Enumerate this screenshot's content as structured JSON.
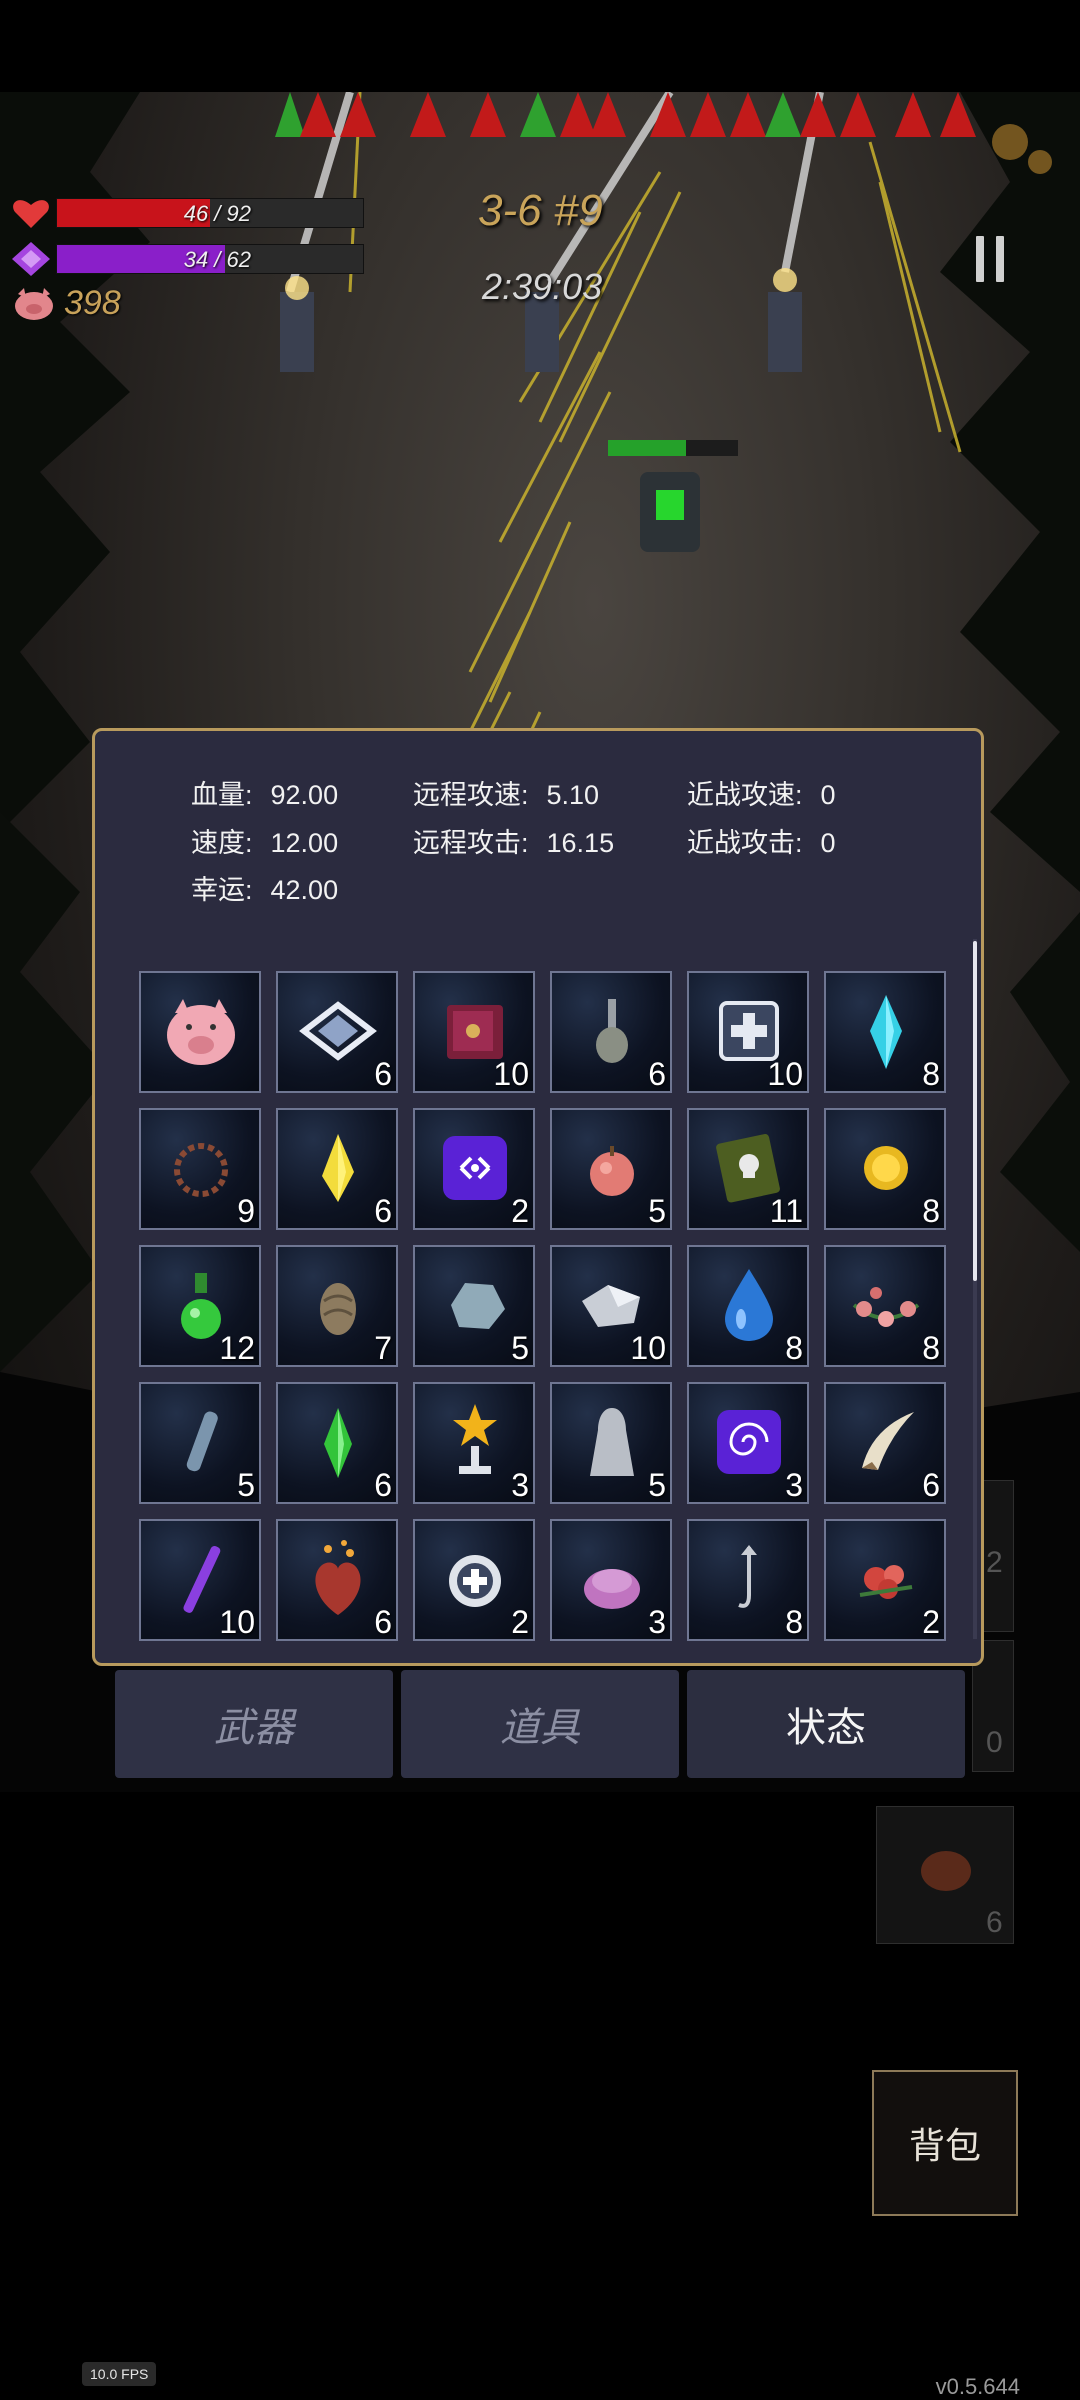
{
  "hud": {
    "hp_text": "46 / 92",
    "hp_fraction": 0.5,
    "hp_color": "#c8131b",
    "mp_text": "34 / 62",
    "mp_fraction": 0.548,
    "mp_color": "#8a1fc9",
    "gold": "398",
    "stage": "3-6 #9",
    "timer": "2:39:03",
    "icons": [
      "heart-icon",
      "mana-gem-icon",
      "piggy-icon",
      "pause-icon"
    ]
  },
  "stats": {
    "hp_label": "血量:",
    "hp_value": "92.00",
    "speed_label": "速度:",
    "speed_value": "12.00",
    "luck_label": "幸运:",
    "luck_value": "42.00",
    "ranged_speed_label": "远程攻速:",
    "ranged_speed_value": "5.10",
    "ranged_attack_label": "远程攻击:",
    "ranged_attack_value": "16.15",
    "melee_speed_label": "近战攻速:",
    "melee_speed_value": "0",
    "melee_attack_label": "近战攻击:",
    "melee_attack_value": "0"
  },
  "items": [
    {
      "icon": "piggy-bank-icon",
      "count": ""
    },
    {
      "icon": "diamond-plate-icon",
      "count": "6"
    },
    {
      "icon": "spellbook-icon",
      "count": "10"
    },
    {
      "icon": "vase-icon",
      "count": "6"
    },
    {
      "icon": "medkit-box-icon",
      "count": "10"
    },
    {
      "icon": "cyan-crystal-icon",
      "count": "8"
    },
    {
      "icon": "thorn-ring-icon",
      "count": "9"
    },
    {
      "icon": "yellow-gem-icon",
      "count": "6"
    },
    {
      "icon": "purple-rune-icon",
      "count": "2"
    },
    {
      "icon": "peach-fruit-icon",
      "count": "5"
    },
    {
      "icon": "skull-book-icon",
      "count": "11"
    },
    {
      "icon": "gold-orb-icon",
      "count": "8"
    },
    {
      "icon": "green-potion-icon",
      "count": "12"
    },
    {
      "icon": "seed-pod-icon",
      "count": "7"
    },
    {
      "icon": "stone-icon",
      "count": "5"
    },
    {
      "icon": "silver-ore-icon",
      "count": "10"
    },
    {
      "icon": "water-drop-icon",
      "count": "8"
    },
    {
      "icon": "flower-garland-icon",
      "count": "8"
    },
    {
      "icon": "vial-icon",
      "count": "5"
    },
    {
      "icon": "green-crystal-icon",
      "count": "6"
    },
    {
      "icon": "star-trophy-icon",
      "count": "3"
    },
    {
      "icon": "cloak-figure-icon",
      "count": "5"
    },
    {
      "icon": "purple-swirl-icon",
      "count": "3"
    },
    {
      "icon": "horn-icon",
      "count": "6"
    },
    {
      "icon": "purple-wand-icon",
      "count": "10"
    },
    {
      "icon": "heart-organ-icon",
      "count": "6"
    },
    {
      "icon": "medal-icon",
      "count": "2"
    },
    {
      "icon": "slime-icon",
      "count": "3"
    },
    {
      "icon": "hook-icon",
      "count": "8"
    },
    {
      "icon": "red-flower-icon",
      "count": "2"
    }
  ],
  "tabs": [
    {
      "label": "武器",
      "active": false
    },
    {
      "label": "道具",
      "active": false
    },
    {
      "label": "状态",
      "active": true
    }
  ],
  "bag_label": "背包",
  "background_numbers": [
    "2",
    "0",
    "6"
  ],
  "fps": "10.0 FPS",
  "version": "v0.5.644"
}
